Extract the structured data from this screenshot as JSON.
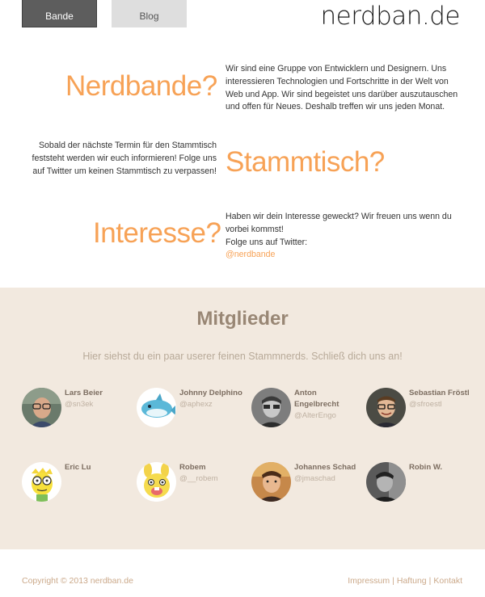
{
  "nav": {
    "tabs": [
      {
        "label": "Bande",
        "active": true
      },
      {
        "label": "Blog",
        "active": false
      }
    ]
  },
  "logo": "nerdban.de",
  "intro": {
    "nerdbande": {
      "title": "Nerdbande?",
      "text": "Wir sind eine Gruppe von Entwicklern und Designern. Uns interessieren Technologien und Fortschritte in der Welt von Web und App. Wir sind begeistet uns darüber auszutauschen und offen für Neues. Deshalb treffen wir uns jeden Monat."
    },
    "stammtisch": {
      "title": "Stammtisch?",
      "text": "Sobald der nächste Termin für den Stammtisch feststeht werden wir euch informieren! Folge uns auf Twitter um keinen Stammtisch zu verpassen!"
    },
    "interesse": {
      "title": "Interesse?",
      "line1": "Haben wir dein Interesse geweckt? Wir freuen uns wenn du vorbei kommst!",
      "line2": "Folge uns auf Twitter:",
      "twitter_link": "@nerdbande"
    }
  },
  "members": {
    "title": "Mitglieder",
    "subtitle": "Hier siehst du ein paar userer feinen Stammnerds. Schließ dich uns an!",
    "list": [
      {
        "name": "Lars Beier",
        "handle": "@sn3ek",
        "avatar": "photo-person-glasses-icon"
      },
      {
        "name": "Johnny Delphino",
        "handle": "@aphexz",
        "avatar": "dolphin-icon"
      },
      {
        "name": "Anton Engelbrecht",
        "handle": "@AlterEngo",
        "avatar": "photo-person-bw-icon"
      },
      {
        "name": "Sebastian Fröstl",
        "handle": "@sfroestl",
        "avatar": "photo-person-smiling-icon"
      },
      {
        "name": "Eric Lu",
        "handle": "",
        "avatar": "cartoon-nerd-icon"
      },
      {
        "name": "Robem",
        "handle": "@__robem",
        "avatar": "cartoon-bunny-icon"
      },
      {
        "name": "Johannes Schad",
        "handle": "@jmaschad",
        "avatar": "photo-person-warm-icon"
      },
      {
        "name": "Robin W.",
        "handle": "",
        "avatar": "photo-person-bw-dark-icon"
      }
    ]
  },
  "footer": {
    "copyright": "Copyright © 2013 nerdban.de",
    "links": [
      "Impressum",
      "Haftung",
      "Kontakt"
    ],
    "separator": "|"
  },
  "colors": {
    "accent": "#f7a256",
    "members_bg": "#f2e9df",
    "members_title": "#998775",
    "nav_active_bg": "#5d5d5d",
    "nav_inactive_bg": "#dedede"
  }
}
